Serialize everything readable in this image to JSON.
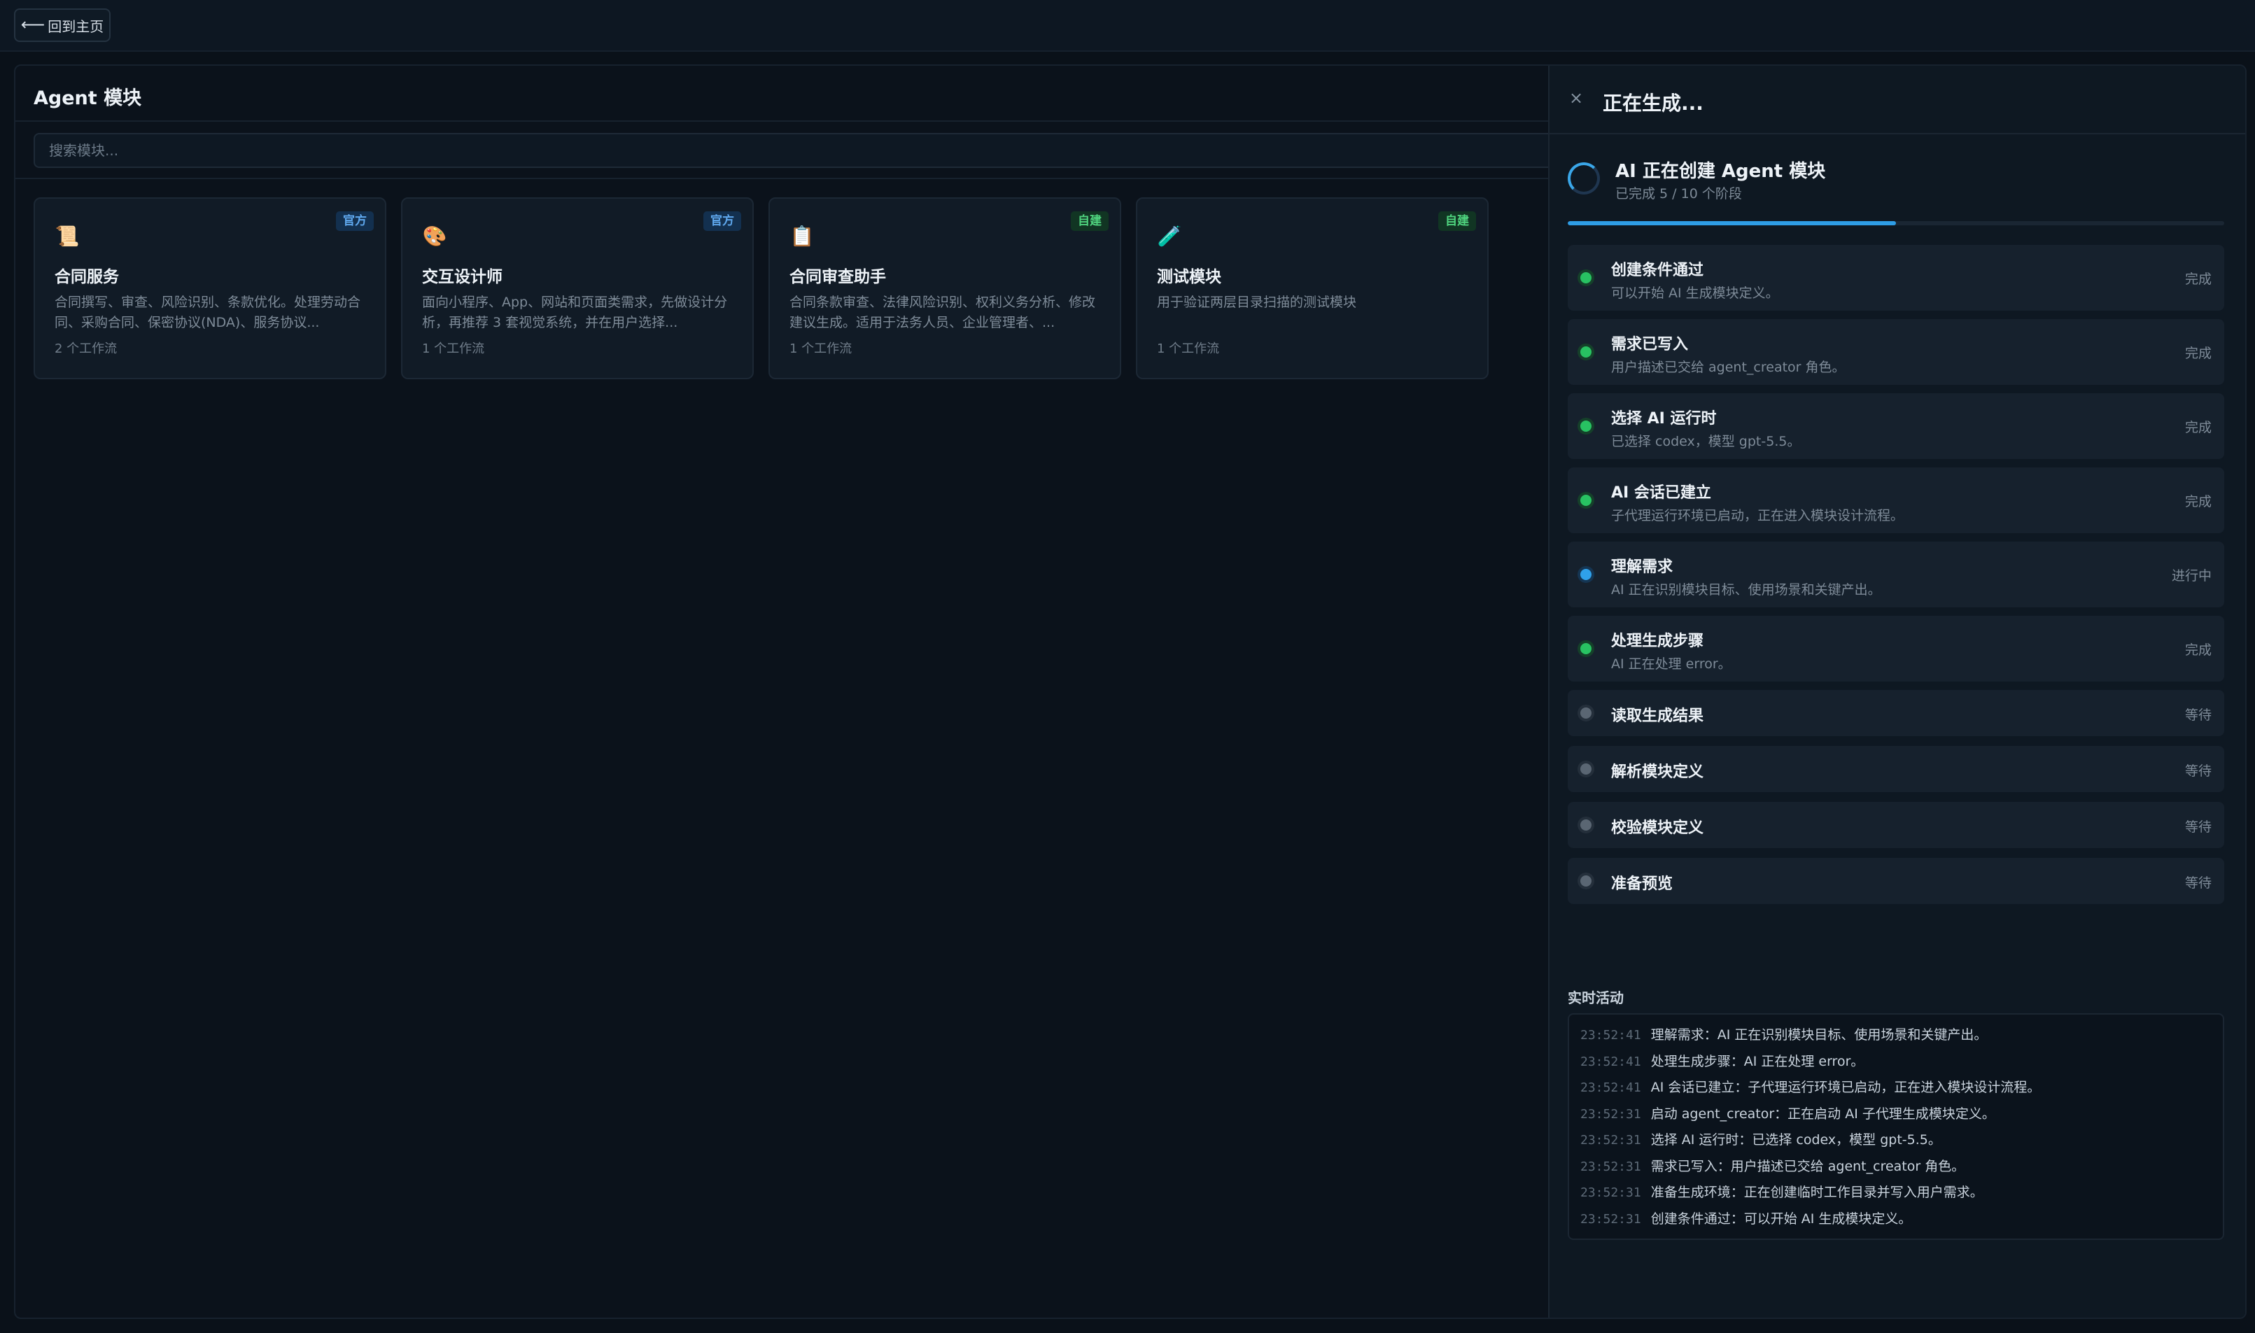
{
  "topbar": {
    "back_label": "回到主页",
    "back_icon": "arrow-left-icon"
  },
  "modules": {
    "title": "Agent 模块",
    "search_placeholder": "搜索模块...",
    "cards": [
      {
        "icon": "📜",
        "icon_name": "scroll-icon",
        "badge": "官方",
        "badge_type": "official",
        "title": "合同服务",
        "desc": "合同撰写、审查、风险识别、条款优化。处理劳动合同、采购合同、保密协议(NDA)、服务协议...",
        "count": "2 个工作流"
      },
      {
        "icon": "🎨",
        "icon_name": "palette-icon",
        "badge": "官方",
        "badge_type": "official",
        "title": "交互设计师",
        "desc": "面向小程序、App、网站和页面类需求，先做设计分析，再推荐 3 套视觉系统，并在用户选择...",
        "count": "1 个工作流"
      },
      {
        "icon": "📋",
        "icon_name": "clipboard-icon",
        "badge": "自建",
        "badge_type": "custom",
        "title": "合同审查助手",
        "desc": "合同条款审查、法律风险识别、权利义务分析、修改建议生成。适用于法务人员、企业管理者、...",
        "count": "1 个工作流"
      },
      {
        "icon": "🧪",
        "icon_name": "test-tube-icon",
        "badge": "自建",
        "badge_type": "custom",
        "title": "测试模块",
        "desc": "用于验证两层目录扫描的测试模块",
        "count": "1 个工作流"
      }
    ]
  },
  "panel": {
    "close_icon": "close-icon",
    "title": "正在生成...",
    "generation": {
      "title": "AI 正在创建 Agent 模块",
      "subtitle": "已完成 5 / 10 个阶段",
      "progress": 0.5
    },
    "steps": [
      {
        "title": "创建条件通过",
        "subtitle": "可以开始 AI 生成模块定义。",
        "status": "完成",
        "state": "done"
      },
      {
        "title": "需求已写入",
        "subtitle": "用户描述已交给 agent_creator 角色。",
        "status": "完成",
        "state": "done"
      },
      {
        "title": "选择 AI 运行时",
        "subtitle": "已选择 codex，模型 gpt-5.5。",
        "status": "完成",
        "state": "done"
      },
      {
        "title": "AI 会话已建立",
        "subtitle": "子代理运行环境已启动，正在进入模块设计流程。",
        "status": "完成",
        "state": "done"
      },
      {
        "title": "理解需求",
        "subtitle": "AI 正在识别模块目标、使用场景和关键产出。",
        "status": "进行中",
        "state": "running"
      },
      {
        "title": "处理生成步骤",
        "subtitle": "AI 正在处理 error。",
        "status": "完成",
        "state": "done"
      },
      {
        "title": "读取生成结果",
        "subtitle": "",
        "status": "等待",
        "state": "waiting"
      },
      {
        "title": "解析模块定义",
        "subtitle": "",
        "status": "等待",
        "state": "waiting"
      },
      {
        "title": "校验模块定义",
        "subtitle": "",
        "status": "等待",
        "state": "waiting"
      },
      {
        "title": "准备预览",
        "subtitle": "",
        "status": "等待",
        "state": "waiting"
      }
    ],
    "activity": {
      "label": "实时活动",
      "logs": [
        {
          "time": "23:52:41",
          "text": "理解需求：AI 正在识别模块目标、使用场景和关键产出。"
        },
        {
          "time": "23:52:41",
          "text": "处理生成步骤：AI 正在处理 error。"
        },
        {
          "time": "23:52:41",
          "text": "AI 会话已建立：子代理运行环境已启动，正在进入模块设计流程。"
        },
        {
          "time": "23:52:31",
          "text": "启动 agent_creator：正在启动 AI 子代理生成模块定义。"
        },
        {
          "time": "23:52:31",
          "text": "选择 AI 运行时：已选择 codex，模型 gpt-5.5。"
        },
        {
          "time": "23:52:31",
          "text": "需求已写入：用户描述已交给 agent_creator 角色。"
        },
        {
          "time": "23:52:31",
          "text": "准备生成环境：正在创建临时工作目录并写入用户需求。"
        },
        {
          "time": "23:52:31",
          "text": "创建条件通过：可以开始 AI 生成模块定义。"
        }
      ]
    }
  }
}
